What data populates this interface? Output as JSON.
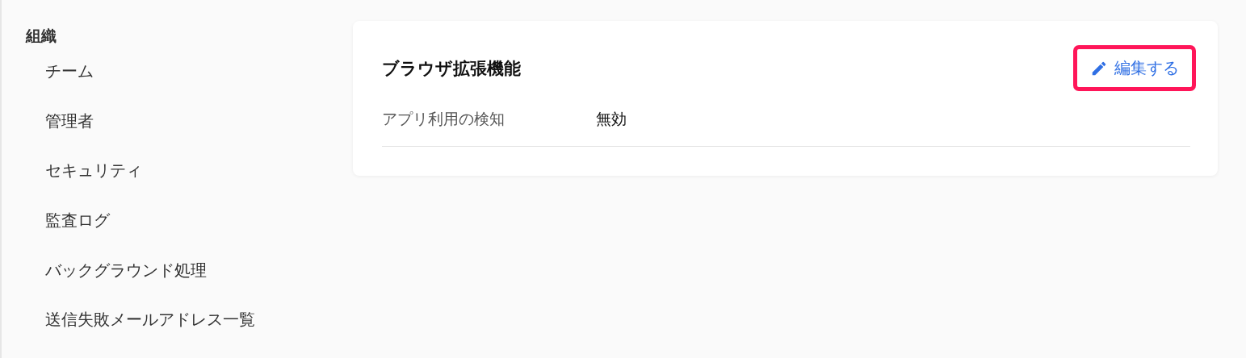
{
  "sidebar": {
    "heading": "組織",
    "items": [
      {
        "label": "チーム"
      },
      {
        "label": "管理者"
      },
      {
        "label": "セキュリティ"
      },
      {
        "label": "監査ログ"
      },
      {
        "label": "バックグラウンド処理"
      },
      {
        "label": "送信失敗メールアドレス一覧"
      }
    ]
  },
  "card": {
    "title": "ブラウザ拡張機能",
    "edit_button": {
      "label": "編集する",
      "highlighted": true
    },
    "rows": [
      {
        "label": "アプリ利用の検知",
        "value": "無効"
      }
    ]
  }
}
